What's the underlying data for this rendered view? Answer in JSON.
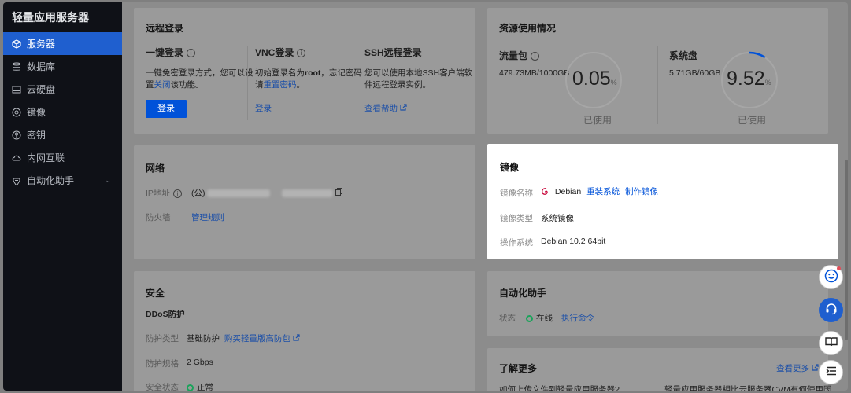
{
  "sidebar": {
    "title": "轻量应用服务器",
    "items": [
      {
        "label": "服务器",
        "icon": "cube-icon"
      },
      {
        "label": "数据库",
        "icon": "database-icon"
      },
      {
        "label": "云硬盘",
        "icon": "disk-icon"
      },
      {
        "label": "镜像",
        "icon": "image-icon"
      },
      {
        "label": "密钥",
        "icon": "key-icon"
      },
      {
        "label": "内网互联",
        "icon": "cloud-link-icon"
      },
      {
        "label": "自动化助手",
        "icon": "robot-icon"
      }
    ]
  },
  "remote": {
    "title": "远程登录",
    "one_click": {
      "title": "一键登录",
      "desc1": "一键免密登录方式，您可以设",
      "desc2_pre": "置",
      "desc2_link": "关闭",
      "desc2_post": "该功能。",
      "button": "登录"
    },
    "vnc": {
      "title": "VNC登录",
      "desc1_pre": "初始登录名为",
      "desc1_bold": "root",
      "desc1_post": "，忘记密码",
      "desc2_pre": "请",
      "desc2_link": "重置密码",
      "desc2_post": "。",
      "link": "登录"
    },
    "ssh": {
      "title": "SSH远程登录",
      "desc1": "您可以使用本地SSH客户端软",
      "desc2": "件远程登录实例。",
      "link": "查看帮助"
    }
  },
  "resource": {
    "title": "资源使用情况",
    "traffic": {
      "label": "流量包",
      "value_text": "479.73MB/1000GB",
      "percent": "0.05",
      "unit": "%",
      "caption": "已使用",
      "fraction": 0.0005
    },
    "disk": {
      "label": "系统盘",
      "value_text": "5.71GB/60GB",
      "percent": "9.52",
      "unit": "%",
      "caption": "已使用",
      "fraction": 0.0952
    }
  },
  "network": {
    "title": "网络",
    "ip_label": "IP地址",
    "ip_prefix": "(公)",
    "firewall_label": "防火墙",
    "firewall_link": "管理规则"
  },
  "image": {
    "title": "镜像",
    "name_label": "镜像名称",
    "name_value": "Debian",
    "reinstall": "重装系统",
    "make_image": "制作镜像",
    "type_label": "镜像类型",
    "type_value": "系统镜像",
    "os_label": "操作系统",
    "os_value": "Debian 10.2 64bit"
  },
  "security": {
    "title": "安全",
    "ddos": "DDoS防护",
    "protect_type_label": "防护类型",
    "protect_type_value": "基础防护",
    "buy_link": "购买轻量版高防包",
    "spec_label": "防护规格",
    "spec_value": "2 Gbps",
    "status_label": "安全状态",
    "status_value": "正常"
  },
  "automation": {
    "title": "自动化助手",
    "status_label": "状态",
    "status_value": "在线",
    "run_link": "执行命令"
  },
  "more": {
    "title": "了解更多",
    "view_more": "查看更多",
    "q1": "如何上传文件到轻量应用服务器?",
    "q2": "轻量应用服务器相比云服务器CVM有何使用因"
  },
  "colors": {
    "primary": "#0052d9",
    "sidebar_bg": "#0f1117",
    "success": "#1aa35a"
  }
}
